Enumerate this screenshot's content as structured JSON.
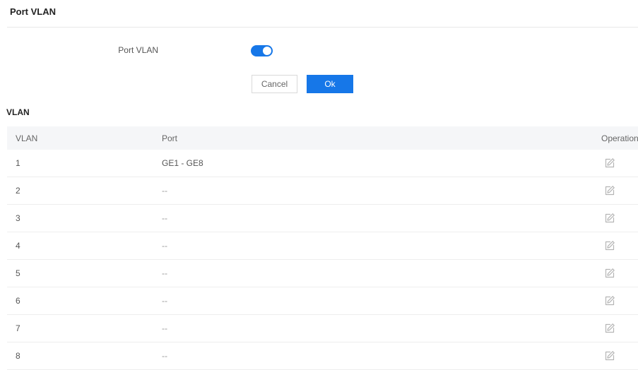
{
  "page": {
    "title": "Port VLAN"
  },
  "form": {
    "port_vlan_label": "Port VLAN",
    "port_vlan_enabled": true,
    "cancel_label": "Cancel",
    "ok_label": "Ok"
  },
  "colors": {
    "accent": "#1677e8"
  },
  "vlan_section": {
    "title": "VLAN",
    "columns": [
      "VLAN",
      "Port",
      "Operation"
    ],
    "rows": [
      {
        "vlan": "1",
        "port": "GE1 - GE8",
        "operation_icon": "edit-icon"
      },
      {
        "vlan": "2",
        "port": "--",
        "operation_icon": "edit-icon"
      },
      {
        "vlan": "3",
        "port": "--",
        "operation_icon": "edit-icon"
      },
      {
        "vlan": "4",
        "port": "--",
        "operation_icon": "edit-icon"
      },
      {
        "vlan": "5",
        "port": "--",
        "operation_icon": "edit-icon"
      },
      {
        "vlan": "6",
        "port": "--",
        "operation_icon": "edit-icon"
      },
      {
        "vlan": "7",
        "port": "--",
        "operation_icon": "edit-icon"
      },
      {
        "vlan": "8",
        "port": "--",
        "operation_icon": "edit-icon"
      }
    ]
  }
}
